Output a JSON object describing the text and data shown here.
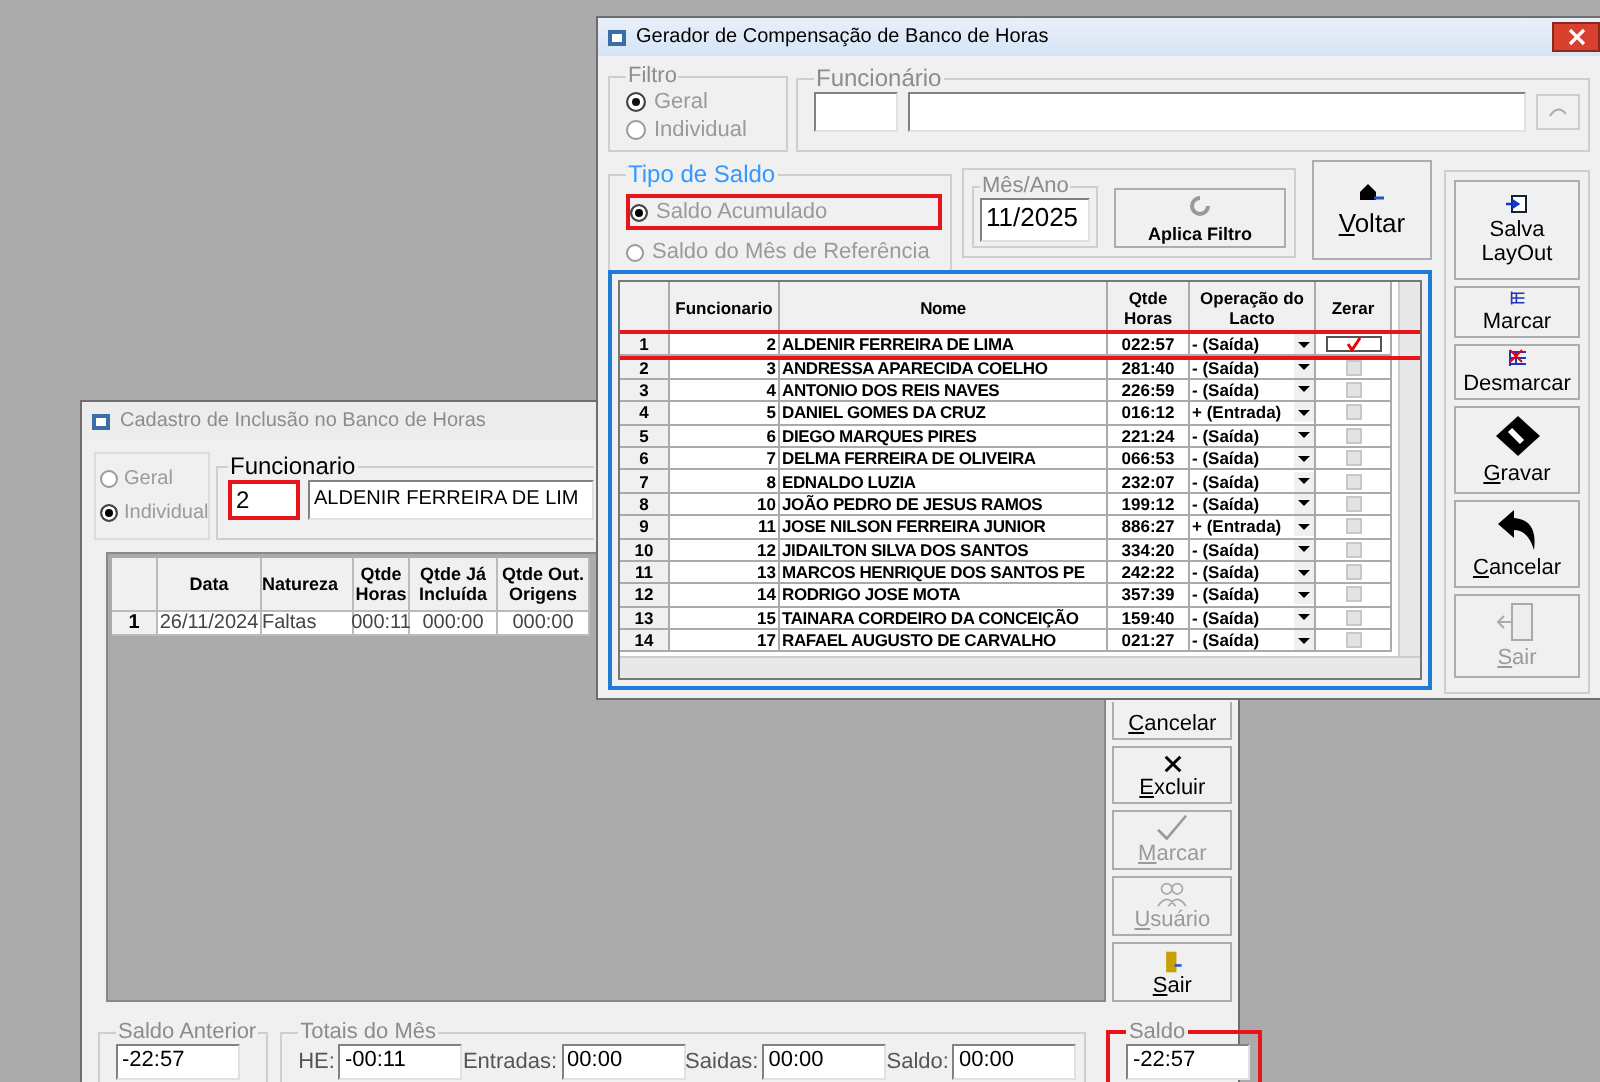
{
  "back_window": {
    "title": "Cadastro de Inclusão no Banco de Horas",
    "filter": {
      "options": [
        {
          "label": "Geral",
          "selected": false,
          "disabled": true
        },
        {
          "label": "Individual",
          "selected": true,
          "disabled": true
        }
      ]
    },
    "funcionario": {
      "label": "Funcionario",
      "id": "2",
      "id_highlighted": true,
      "name": "ALDENIR FERREIRA DE LIM"
    },
    "grid": {
      "columns": [
        "Data",
        "Natureza",
        "Qtde Horas",
        "Qtde Já Incluída",
        "Qtde Out. Origens"
      ],
      "rows": [
        {
          "num": "1",
          "cells": [
            "26/11/2024",
            "Faltas",
            "000:11",
            "000:00",
            "000:00"
          ]
        }
      ]
    },
    "buttons": [
      {
        "label": "Cancelar",
        "kind": "hidden-icon",
        "disabled": false
      },
      {
        "label": "Excluir",
        "kind": "delete",
        "disabled": false
      },
      {
        "label": "Marcar",
        "kind": "check",
        "disabled": true
      },
      {
        "label": "Usuário",
        "kind": "user",
        "disabled": true
      },
      {
        "label": "Sair",
        "kind": "exit",
        "disabled": false
      }
    ],
    "saldo_anterior": {
      "label": "Saldo Anterior",
      "value": "-22:57"
    },
    "totais": {
      "label": "Totais do Mês",
      "fields": [
        {
          "label": "HE:",
          "value": "-00:11"
        },
        {
          "label": "Entradas:",
          "value": "00:00"
        },
        {
          "label": "Saidas:",
          "value": "00:00"
        },
        {
          "label": "Saldo:",
          "value": "00:00"
        }
      ]
    },
    "saldo": {
      "label": "Saldo",
      "value": "-22:57",
      "highlighted": true
    }
  },
  "front_window": {
    "title": "Gerador de Compensação de Banco de Horas",
    "filter": {
      "label": "Filtro",
      "options": [
        {
          "label": "Geral",
          "selected": true,
          "disabled": true
        },
        {
          "label": "Individual",
          "selected": false,
          "disabled": true
        }
      ]
    },
    "funcionario": {
      "label": "Funcionário"
    },
    "tipo_saldo": {
      "label": "Tipo de Saldo",
      "options": [
        {
          "label": "Saldo Acumulado",
          "selected": true,
          "highlighted": true
        },
        {
          "label": "Saldo do Mês de Referência",
          "selected": false,
          "highlighted": false
        }
      ]
    },
    "mes_ano": {
      "label": "Mês/Ano",
      "value": "11/2025"
    },
    "apply_button": "Aplica Filtro",
    "back_button": "Voltar",
    "grid": {
      "columns": [
        "Funcionario",
        "Nome",
        "Qtde Horas",
        "Operação do Lacto",
        "Zerar"
      ],
      "rows": [
        {
          "num": "1",
          "id": "2",
          "name": "ALDENIR FERREIRA DE LIMA",
          "hours": "022:57",
          "operation": "- (Saída)",
          "zerar": true,
          "highlighted": true
        },
        {
          "num": "2",
          "id": "3",
          "name": "ANDRESSA APARECIDA COELHO",
          "hours": "281:40",
          "operation": "- (Saída)",
          "zerar": false,
          "highlighted": false
        },
        {
          "num": "3",
          "id": "4",
          "name": "ANTONIO DOS REIS NAVES",
          "hours": "226:59",
          "operation": "- (Saída)",
          "zerar": false,
          "highlighted": false
        },
        {
          "num": "4",
          "id": "5",
          "name": "DANIEL GOMES DA CRUZ",
          "hours": "016:12",
          "operation": "+ (Entrada)",
          "zerar": false,
          "highlighted": false
        },
        {
          "num": "5",
          "id": "6",
          "name": "DIEGO MARQUES PIRES",
          "hours": "221:24",
          "operation": "- (Saída)",
          "zerar": false,
          "highlighted": false
        },
        {
          "num": "6",
          "id": "7",
          "name": "DELMA FERREIRA DE OLIVEIRA",
          "hours": "066:53",
          "operation": "- (Saída)",
          "zerar": false,
          "highlighted": false
        },
        {
          "num": "7",
          "id": "8",
          "name": "EDNALDO LUZIA",
          "hours": "232:07",
          "operation": "- (Saída)",
          "zerar": false,
          "highlighted": false
        },
        {
          "num": "8",
          "id": "10",
          "name": "JOÃO PEDRO DE JESUS RAMOS",
          "hours": "199:12",
          "operation": "- (Saída)",
          "zerar": false,
          "highlighted": false
        },
        {
          "num": "9",
          "id": "11",
          "name": "JOSE NILSON FERREIRA JUNIOR",
          "hours": "886:27",
          "operation": "+ (Entrada)",
          "zerar": false,
          "highlighted": false
        },
        {
          "num": "10",
          "id": "12",
          "name": "JIDAILTON SILVA DOS SANTOS",
          "hours": "334:20",
          "operation": "- (Saída)",
          "zerar": false,
          "highlighted": false
        },
        {
          "num": "11",
          "id": "13",
          "name": "MARCOS HENRIQUE DOS SANTOS PE",
          "hours": "242:22",
          "operation": "- (Saída)",
          "zerar": false,
          "highlighted": false
        },
        {
          "num": "12",
          "id": "14",
          "name": "RODRIGO JOSE MOTA",
          "hours": "357:39",
          "operation": "- (Saída)",
          "zerar": false,
          "highlighted": false
        },
        {
          "num": "13",
          "id": "15",
          "name": "TAINARA CORDEIRO DA CONCEIÇÃO",
          "hours": "159:40",
          "operation": "- (Saída)",
          "zerar": false,
          "highlighted": false
        },
        {
          "num": "14",
          "id": "17",
          "name": "RAFAEL AUGUSTO DE CARVALHO",
          "hours": "021:27",
          "operation": "- (Saída)",
          "zerar": false,
          "highlighted": false
        }
      ]
    },
    "side_buttons": [
      {
        "label": "Salva LayOut",
        "kind": "save-layout",
        "disabled": false,
        "mnemonic": false
      },
      {
        "label": "Marcar",
        "kind": "mark",
        "disabled": false,
        "mnemonic": false
      },
      {
        "label": "Desmarcar",
        "kind": "unmark",
        "disabled": false,
        "mnemonic": false
      },
      {
        "label": "Gravar",
        "kind": "disk",
        "disabled": false,
        "mnemonic": true
      },
      {
        "label": "Cancelar",
        "kind": "undo",
        "disabled": false,
        "mnemonic": true
      },
      {
        "label": "Sair",
        "kind": "door",
        "disabled": true,
        "mnemonic": true
      }
    ]
  }
}
